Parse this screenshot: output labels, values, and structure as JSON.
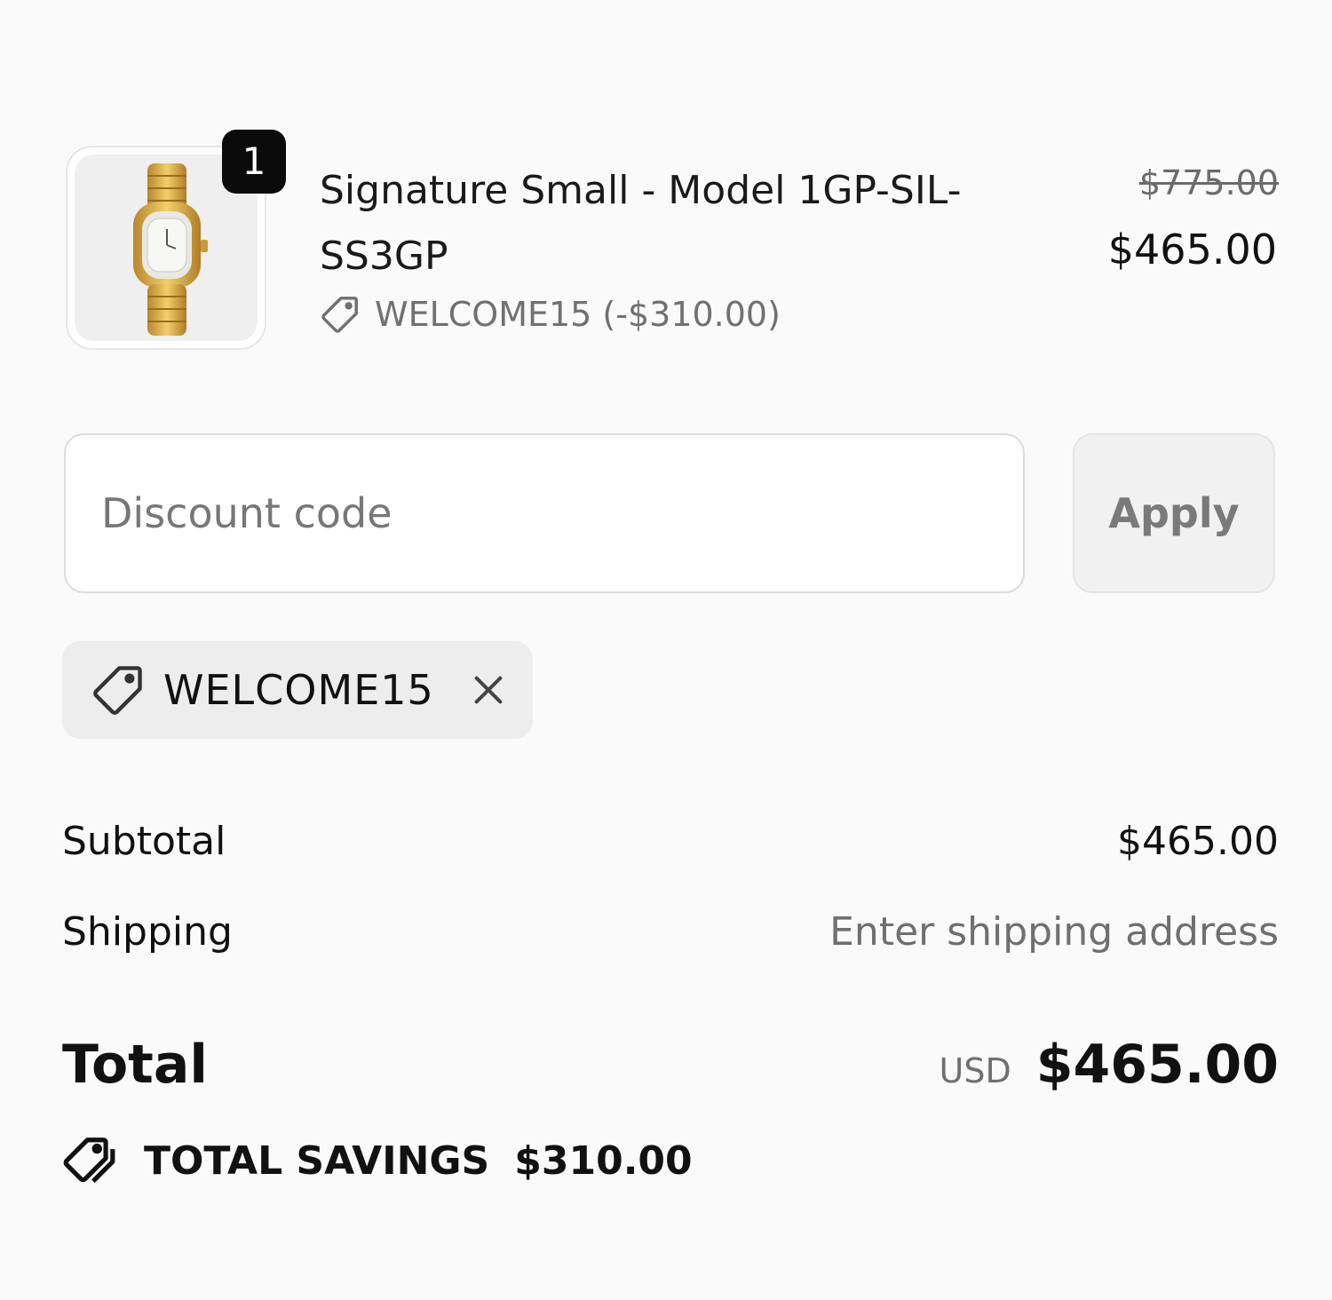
{
  "product": {
    "quantity": "1",
    "title": "Signature Small - Model 1GP-SIL-SS3GP",
    "discount_line": "WELCOME15 (-$310.00)",
    "original_price": "$775.00",
    "price": "$465.00",
    "image_icon": "gold-watch-image"
  },
  "discount": {
    "placeholder": "Discount code",
    "value": "",
    "apply_label": "Apply",
    "applied_code": "WELCOME15"
  },
  "summary": {
    "subtotal_label": "Subtotal",
    "subtotal_value": "$465.00",
    "shipping_label": "Shipping",
    "shipping_value": "Enter shipping address",
    "total_label": "Total",
    "total_currency": "USD",
    "total_value": "$465.00",
    "savings_label": "TOTAL SAVINGS",
    "savings_value": "$310.00"
  },
  "colors": {
    "background": "#fafafa",
    "badge": "#0b0b0b",
    "chip": "#ededed",
    "muted_text": "#6f6f6f"
  }
}
